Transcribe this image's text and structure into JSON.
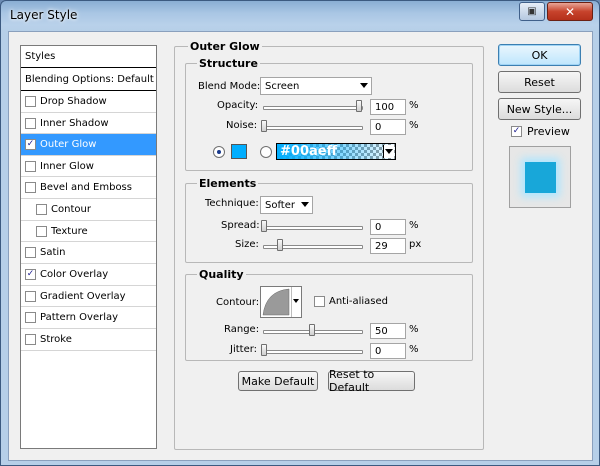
{
  "window": {
    "title": "Layer Style",
    "close_glyph": "✕",
    "help_glyph": "▣"
  },
  "styles_panel": {
    "items": [
      {
        "label": "Styles",
        "checked": null
      },
      {
        "label": "Blending Options: Default",
        "checked": null
      },
      {
        "label": "Drop Shadow",
        "checked": false
      },
      {
        "label": "Inner Shadow",
        "checked": false
      },
      {
        "label": "Outer Glow",
        "checked": true
      },
      {
        "label": "Inner Glow",
        "checked": false
      },
      {
        "label": "Bevel and Emboss",
        "checked": false
      },
      {
        "label": "Contour",
        "checked": false
      },
      {
        "label": "Texture",
        "checked": false
      },
      {
        "label": "Satin",
        "checked": false
      },
      {
        "label": "Color Overlay",
        "checked": true
      },
      {
        "label": "Gradient Overlay",
        "checked": false
      },
      {
        "label": "Pattern Overlay",
        "checked": false
      },
      {
        "label": "Stroke",
        "checked": false
      }
    ],
    "check_glyph": "✓"
  },
  "outer_glow": {
    "title": "Outer Glow",
    "structure": {
      "title": "Structure",
      "blend_mode_label": "Blend Mode:",
      "blend_mode_value": "Screen",
      "opacity_label": "Opacity:",
      "opacity_value": "100",
      "noise_label": "Noise:",
      "noise_value": "0",
      "percent": "%",
      "color_hex": "#00aeff",
      "gradient_text": "#00aeff"
    },
    "elements": {
      "title": "Elements",
      "technique_label": "Technique:",
      "technique_value": "Softer",
      "spread_label": "Spread:",
      "spread_value": "0",
      "size_label": "Size:",
      "size_value": "29",
      "px": "px",
      "percent": "%"
    },
    "quality": {
      "title": "Quality",
      "contour_label": "Contour:",
      "anti_aliased_label": "Anti-aliased",
      "anti_aliased_checked": false,
      "range_label": "Range:",
      "range_value": "50",
      "jitter_label": "Jitter:",
      "jitter_value": "0",
      "percent": "%"
    },
    "make_default_label": "Make Default",
    "reset_to_default_label": "Reset to Default"
  },
  "actions": {
    "ok_label": "OK",
    "reset_label": "Reset",
    "new_style_label": "New Style...",
    "preview_label": "Preview",
    "preview_checked": true
  },
  "colors": {
    "glow": "#00aeff",
    "selection": "#3399ff",
    "preview_fill": "#18a7d9"
  }
}
